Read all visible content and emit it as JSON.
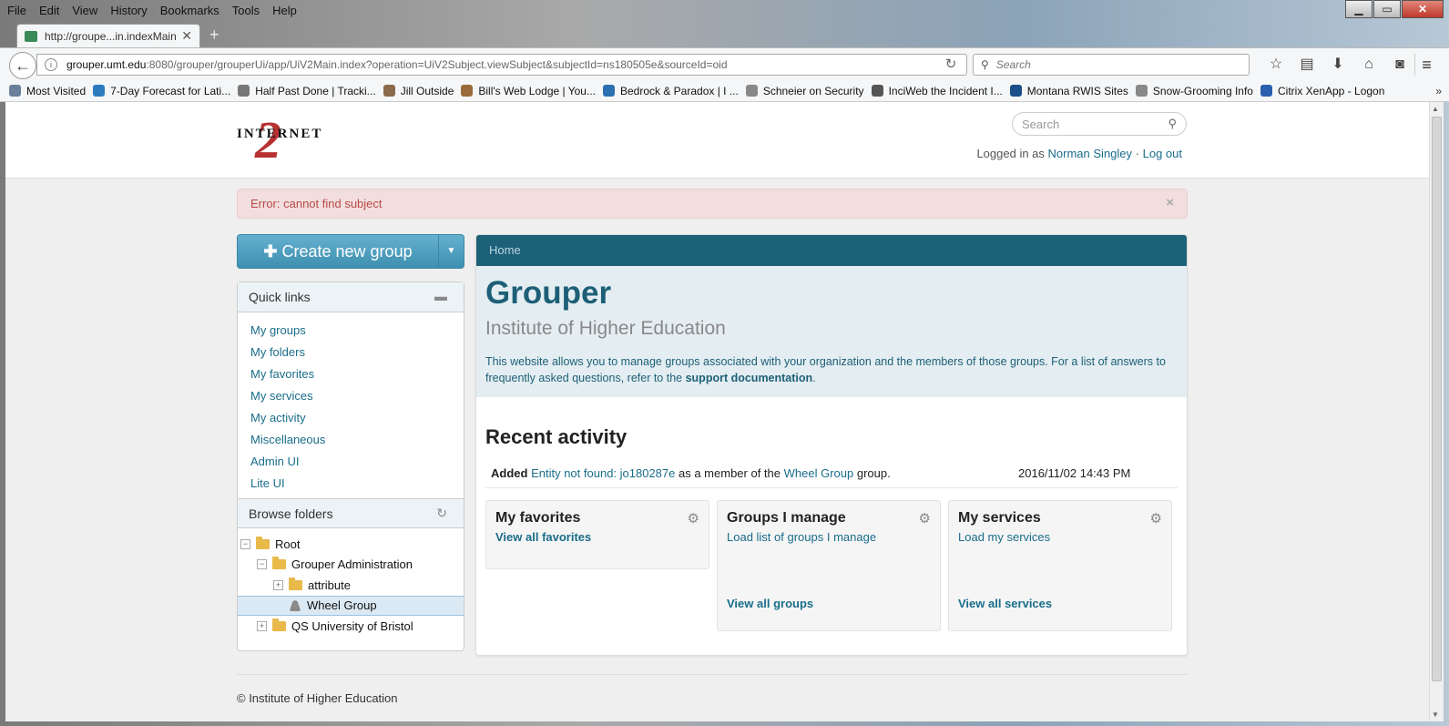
{
  "browser": {
    "menu": [
      "File",
      "Edit",
      "View",
      "History",
      "Bookmarks",
      "Tools",
      "Help"
    ],
    "tab_title": "http://groupe...in.indexMain",
    "url_host": "grouper.umt.edu",
    "url_rest": ":8080/grouper/grouperUi/app/UiV2Main.index?operation=UiV2Subject.viewSubject&subjectId=ns180505e&sourceId=oid",
    "search_placeholder": "Search",
    "bookmarks": [
      "Most Visited",
      "7-Day Forecast for Lati...",
      "Half Past Done | Tracki...",
      "Jill Outside",
      "Bill's Web Lodge | You...",
      "Bedrock & Paradox | I ...",
      "Schneier on Security",
      "InciWeb the Incident I...",
      "Montana RWIS Sites",
      "Snow-Grooming Info",
      "Citrix XenApp - Logon"
    ],
    "bookmark_colors": [
      "#6a7f99",
      "#2c7bbf",
      "#777",
      "#8a6a4a",
      "#9a6a3a",
      "#2c6fb0",
      "#888",
      "#555",
      "#1b4f8a",
      "#888",
      "#2a5fb0"
    ]
  },
  "header": {
    "logo_word": "INTERNET",
    "logo_numeral": "2",
    "search_placeholder": "Search",
    "logged_in_prefix": "Logged in as",
    "user_name": "Norman Singley",
    "separator": "·",
    "logout": "Log out"
  },
  "alert": {
    "message": "Error: cannot find subject",
    "close": "×"
  },
  "sidebar": {
    "create_group": "Create new group",
    "quick_links_title": "Quick links",
    "quick_links": [
      "My groups",
      "My folders",
      "My favorites",
      "My services",
      "My activity",
      "Miscellaneous",
      "Admin UI",
      "Lite UI"
    ],
    "browse_title": "Browse folders",
    "tree": [
      {
        "label": "Root",
        "toggle": "−"
      },
      {
        "label": "Grouper Administration",
        "toggle": "−"
      },
      {
        "label": "attribute",
        "toggle": "+"
      },
      {
        "label": "Wheel Group"
      },
      {
        "label": "QS University of Bristol",
        "toggle": "+"
      }
    ]
  },
  "main": {
    "breadcrumb": "Home",
    "title": "Grouper",
    "subtitle": "Institute of Higher Education",
    "description": "This website allows you to manage groups associated with your organization and the members of those groups. For a list of answers to frequently asked questions, refer to the",
    "support_link": "support documentation",
    "description_end": ".",
    "recent_title": "Recent activity",
    "activity": {
      "verb": "Added",
      "entity": "Entity not found: jo180287e",
      "middle": "as a member of the",
      "group": "Wheel Group",
      "end": "group.",
      "date": "2016/11/02 14:43 PM"
    },
    "tiles": [
      {
        "title": "My favorites",
        "link": "View all favorites",
        "footer_link": ""
      },
      {
        "title": "Groups I manage",
        "link": "Load list of groups I manage",
        "footer_link": "View all groups"
      },
      {
        "title": "My services",
        "link": "Load my services",
        "footer_link": "View all services"
      }
    ]
  },
  "footer": {
    "text": "© Institute of Higher Education"
  }
}
